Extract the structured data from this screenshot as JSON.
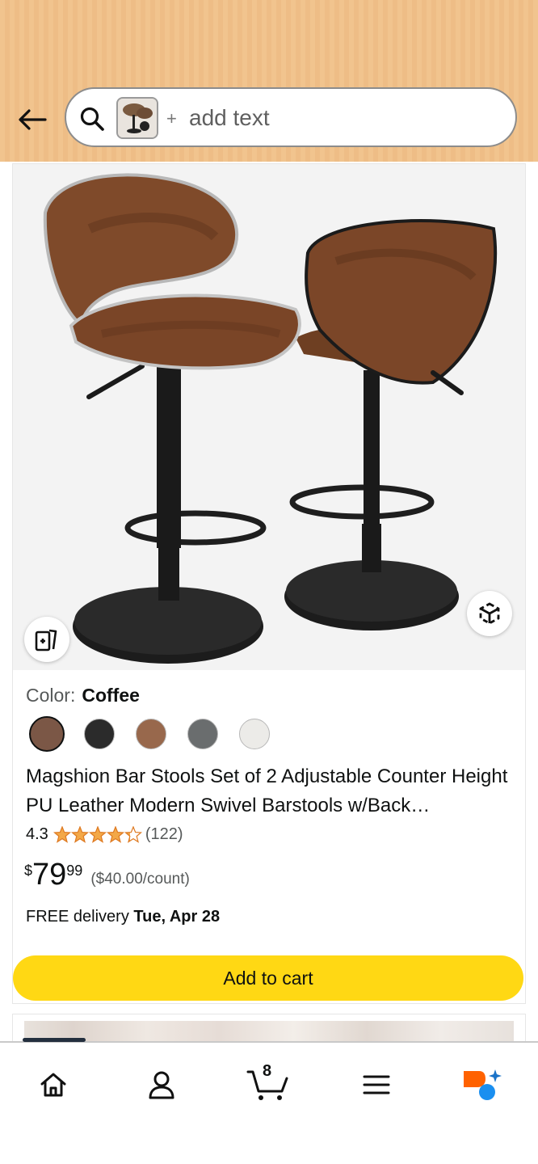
{
  "search": {
    "placeholder_text": "add text",
    "plus_symbol": "+"
  },
  "product": {
    "color_label": "Color:",
    "color_value": "Coffee",
    "swatches": [
      {
        "name": "Coffee",
        "color": "#7b5746",
        "selected": true
      },
      {
        "name": "Black",
        "color": "#2b2b2b",
        "selected": false
      },
      {
        "name": "Brown",
        "color": "#98684c",
        "selected": false
      },
      {
        "name": "Gray",
        "color": "#6a6d6e",
        "selected": false
      },
      {
        "name": "White",
        "color": "#ecebe8",
        "selected": false
      }
    ],
    "title": "Magshion Bar Stools Set of 2 Adjustable Counter Height PU Leather Modern Swivel Barstools w/Back…",
    "rating_value": "4.3",
    "rating_stars": 4.3,
    "rating_count": "(122)",
    "price_symbol": "$",
    "price_whole": "79",
    "price_fraction": "99",
    "unit_price": "($40.00/count)",
    "delivery_prefix": "FREE delivery",
    "delivery_date": "Tue, Apr 28"
  },
  "buttons": {
    "add_to_cart": "Add to cart"
  },
  "nav": {
    "cart_count": "8",
    "items": [
      "home-icon",
      "account-icon",
      "cart-icon",
      "menu-icon",
      "rufus-icon"
    ]
  },
  "colors": {
    "header_bg": "#f1c48e",
    "add_to_cart_bg": "#ffd814",
    "star": "#f3a847",
    "rufus_orange": "#ff6200",
    "rufus_blue": "#1a8ff0"
  }
}
